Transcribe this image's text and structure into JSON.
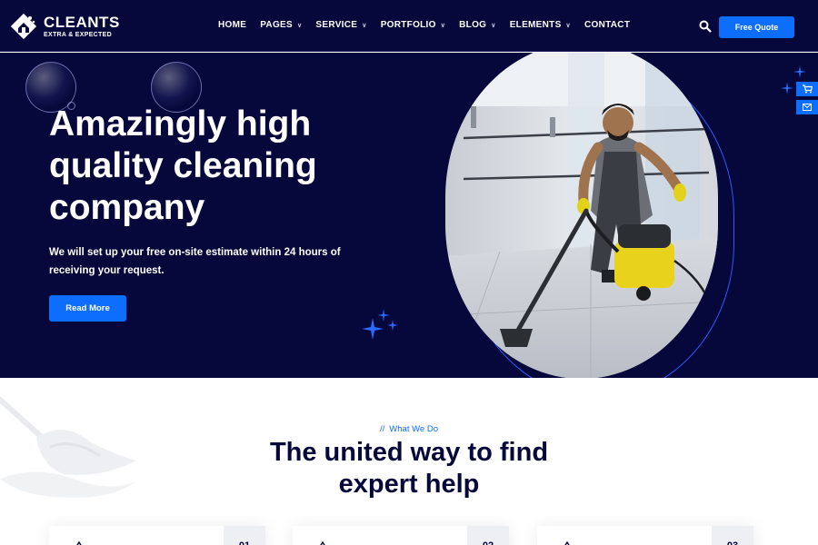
{
  "brand": {
    "name": "CLEANTS",
    "tagline": "EXTRA & EXPECTED"
  },
  "nav": [
    {
      "label": "HOME",
      "dropdown": false
    },
    {
      "label": "PAGES",
      "dropdown": true
    },
    {
      "label": "SERVICE",
      "dropdown": true
    },
    {
      "label": "PORTFOLIO",
      "dropdown": true
    },
    {
      "label": "BLOG",
      "dropdown": true
    },
    {
      "label": "ELEMENTS",
      "dropdown": true
    },
    {
      "label": "CONTACT",
      "dropdown": false
    }
  ],
  "header": {
    "quote_label": "Free Quote",
    "search_icon": "search-icon"
  },
  "hero": {
    "title": "Amazingly high quality cleaning company",
    "subtitle": "We will set up your free on-site estimate within 24 hours of receiving your request.",
    "cta_label": "Read More"
  },
  "side_tabs": [
    "cart-icon",
    "mail-icon"
  ],
  "section": {
    "eyebrow_prefix": "//",
    "eyebrow": "What We Do",
    "title": "The united way to find expert help"
  },
  "cards": [
    {
      "number": "01"
    },
    {
      "number": "02"
    },
    {
      "number": "03"
    }
  ],
  "colors": {
    "navy": "#06073a",
    "accent": "#0d6efd",
    "white": "#ffffff"
  }
}
